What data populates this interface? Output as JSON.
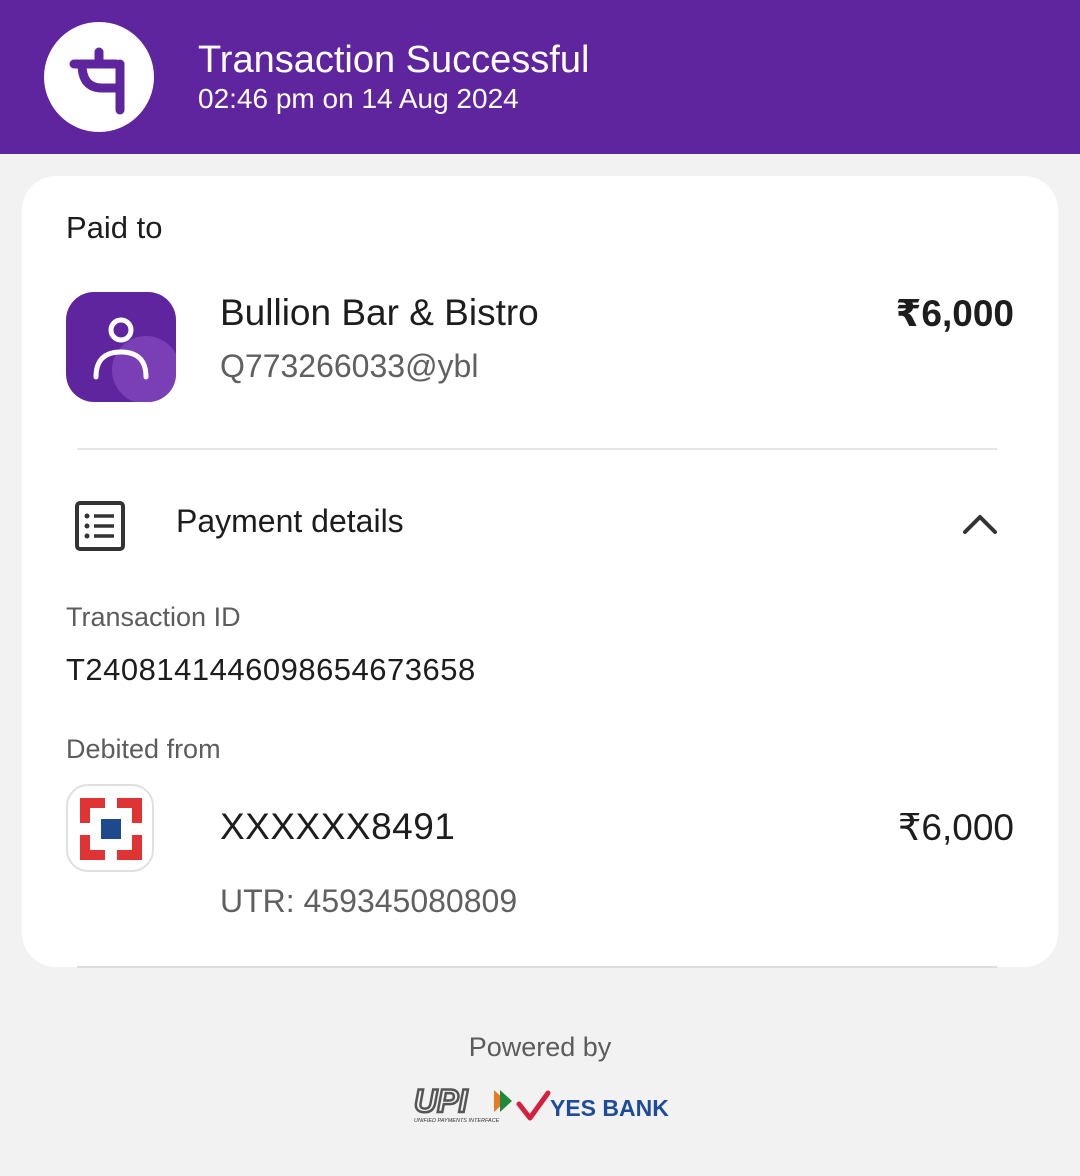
{
  "header": {
    "title": "Transaction Successful",
    "timestamp": "02:46 pm on 14 Aug 2024",
    "app_icon": "phonepe-logo-icon",
    "brand_color": "#5f259f"
  },
  "payee": {
    "section_label": "Paid to",
    "name": "Bullion Bar & Bistro",
    "upi_id": "Q773266033@ybl",
    "amount": "₹6,000",
    "avatar_icon": "person-icon"
  },
  "payment_details": {
    "title": "Payment details",
    "icon": "receipt-list-icon",
    "toggle_icon": "chevron-up-icon",
    "transaction_id_label": "Transaction ID",
    "transaction_id": "T2408141446098654673658",
    "debited_from_label": "Debited from",
    "account_number": "XXXXXX8491",
    "amount": "₹6,000",
    "utr": "UTR: 459345080809",
    "bank_icon": "hdfc-bank-logo-icon"
  },
  "footer": {
    "powered_by": "Powered by",
    "upi_logo": "UPI",
    "upi_tagline": "UNIFIED PAYMENTS INTERFACE",
    "bank_name": "YES BANK"
  }
}
